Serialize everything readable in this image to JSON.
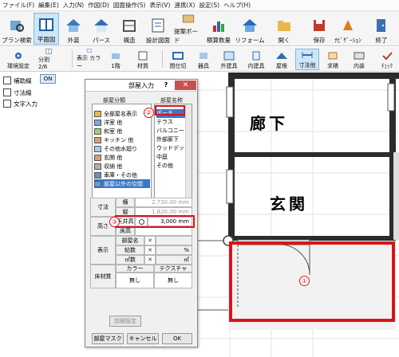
{
  "menu": [
    "ファイル(F)",
    "編集(E)",
    "入力(N)",
    "作図(D)",
    "図面操作(S)",
    "表示(V)",
    "連携(X)",
    "設定(S)",
    "ヘルプ(H)"
  ],
  "toolbar1": [
    {
      "label": "プラン検索"
    },
    {
      "label": "平面図",
      "active": true
    },
    {
      "label": "外装"
    },
    {
      "label": "パース"
    },
    {
      "label": "構造"
    },
    {
      "label": "設計図面"
    },
    {
      "label": "提案ボード"
    },
    {
      "label": "積算数量"
    },
    {
      "label": "リフォーム"
    },
    {
      "label": "開く"
    },
    {
      "label": "保存"
    },
    {
      "label": "ﾅﾋﾞｹﾞｰｼｮﾝ"
    },
    {
      "label": "終了"
    }
  ],
  "toolbar2": [
    {
      "label": "環境設定"
    },
    {
      "label": "分割 2/6"
    },
    {
      "label": "表示 カラー"
    },
    {
      "label": "1階"
    },
    {
      "label": "材質"
    },
    {
      "label": "間仕切"
    },
    {
      "label": "器具"
    },
    {
      "label": "外建具"
    },
    {
      "label": "内建具"
    },
    {
      "label": "屋根"
    },
    {
      "label": "寸法他",
      "active": true
    },
    {
      "label": "求積"
    },
    {
      "label": "内装"
    },
    {
      "label": "ﾁｪｯｸ"
    }
  ],
  "left": {
    "rows": [
      "補助線",
      "寸法線",
      "文字入力"
    ],
    "on_label": "ON"
  },
  "canvas": {
    "room1": "廊下",
    "room2": "玄関",
    "marker1": "①"
  },
  "dialog": {
    "title": "部屋入力",
    "help": "?",
    "close": "✕",
    "col1": "部屋分類",
    "col2": "部屋名称",
    "categories": [
      {
        "label": "全部屋名表示"
      },
      {
        "label": "洋室 他"
      },
      {
        "label": "和室 他"
      },
      {
        "label": "キッチン 他"
      },
      {
        "label": "その他水廻り"
      },
      {
        "label": "玄関 他"
      },
      {
        "label": "収納 他"
      },
      {
        "label": "車庫・その他"
      },
      {
        "label": "部屋以外の空間",
        "selected": true
      }
    ],
    "names": [
      {
        "label": "ポーチ",
        "selected": true
      },
      {
        "label": "テラス"
      },
      {
        "label": "バルコニー"
      },
      {
        "label": "外部廊下"
      },
      {
        "label": "ウッドデッキ"
      },
      {
        "label": "中庭"
      },
      {
        "label": "その他"
      }
    ],
    "marker2": "②",
    "marker3": "③",
    "size_label": "寸法",
    "w_label": "横",
    "w_value": "2,730.00 mm",
    "h_label": "縦",
    "h_value": "1,820.00 mm",
    "height_label": "高さ",
    "ceil_label": "天井高",
    "ceil_value": "3,000 mm",
    "floor_label": "床高",
    "disp_label": "表示",
    "name_label": "部屋名",
    "tatami_label": "帖数",
    "tatami_unit": "%",
    "m2_label": "㎡数",
    "m2_unit": "㎡",
    "floor_mat_label": "床材質",
    "color_label": "カラー",
    "texture_label": "テクスチャ",
    "none1": "無し",
    "none2": "無し",
    "detail_btn": "詳細設定",
    "mask_btn": "部屋マスク",
    "cancel_btn": "キャンセル",
    "ok_btn": "OK"
  }
}
